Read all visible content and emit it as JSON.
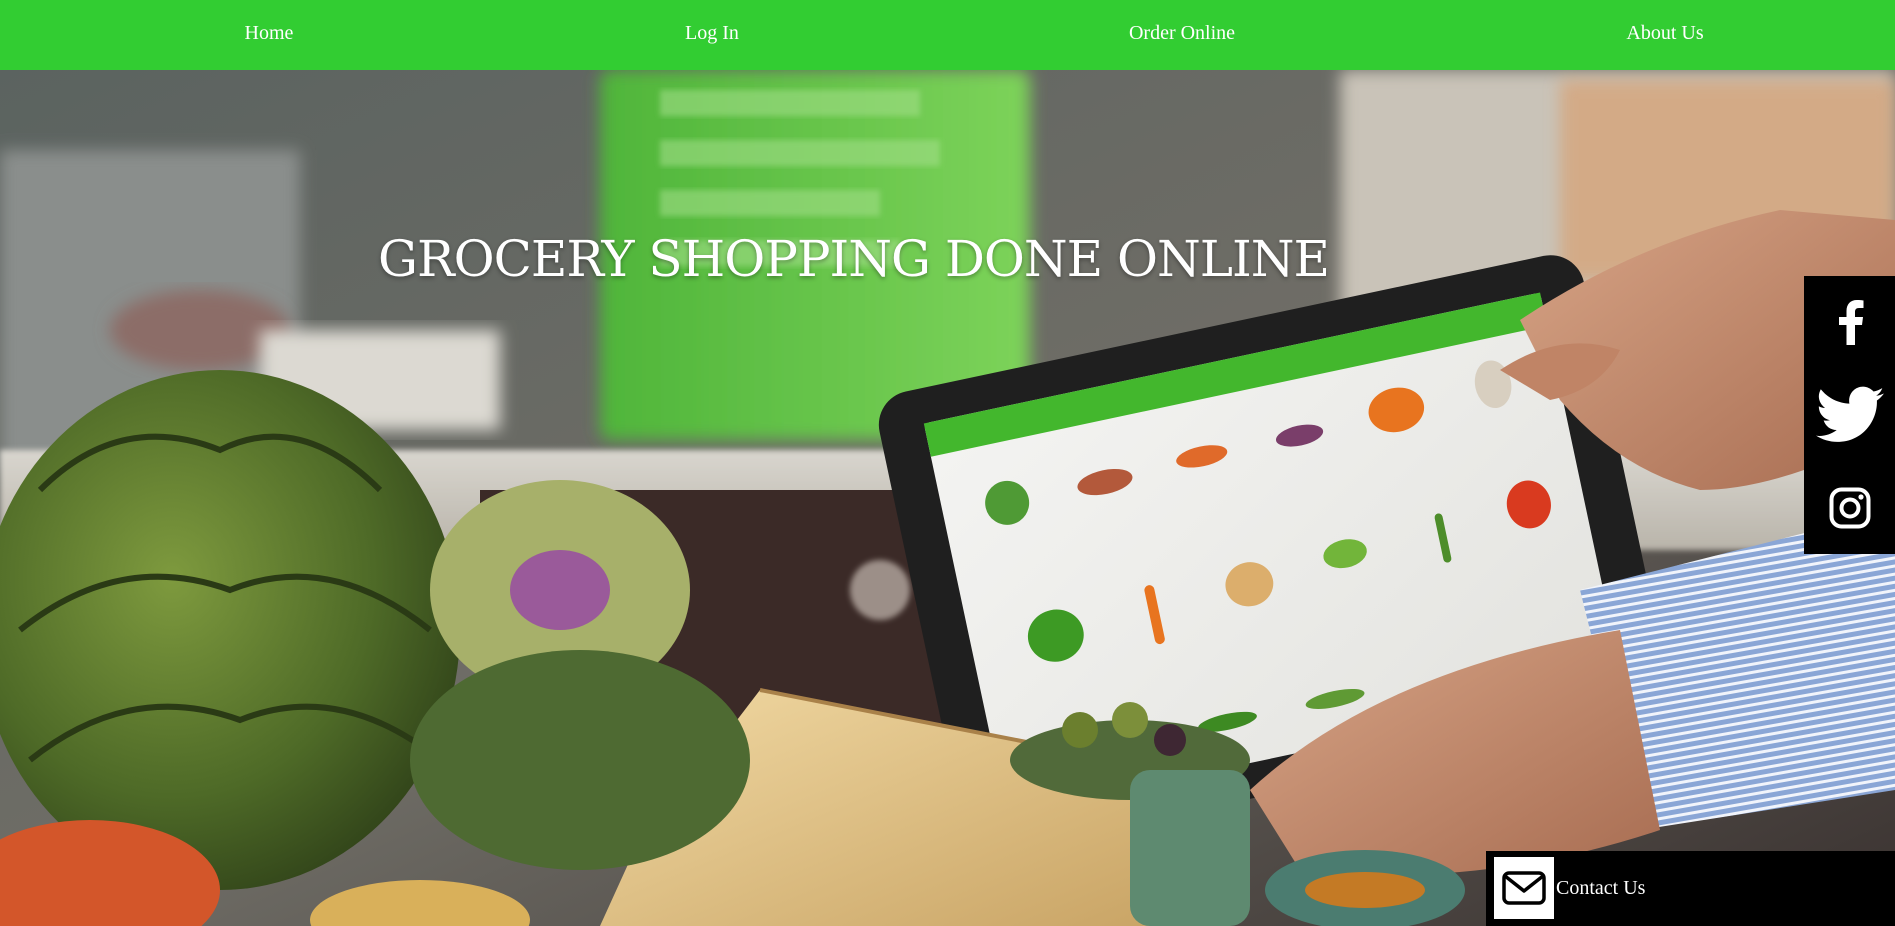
{
  "nav": {
    "items": [
      {
        "label": "Home"
      },
      {
        "label": "Log In"
      },
      {
        "label": "Order Online"
      },
      {
        "label": "About Us"
      }
    ]
  },
  "hero": {
    "title": "GROCERY SHOPPING DONE ONLINE",
    "image_description_icon": "grocery-tablet-photo"
  },
  "social": {
    "items": [
      {
        "icon": "facebook-icon"
      },
      {
        "icon": "twitter-icon"
      },
      {
        "icon": "instagram-icon"
      }
    ]
  },
  "contact": {
    "label": "Contact Us",
    "icon": "envelope-icon"
  },
  "colors": {
    "nav_background": "#32cd32",
    "nav_text": "#ffffff",
    "social_background": "#000000",
    "contact_background": "#000000"
  }
}
